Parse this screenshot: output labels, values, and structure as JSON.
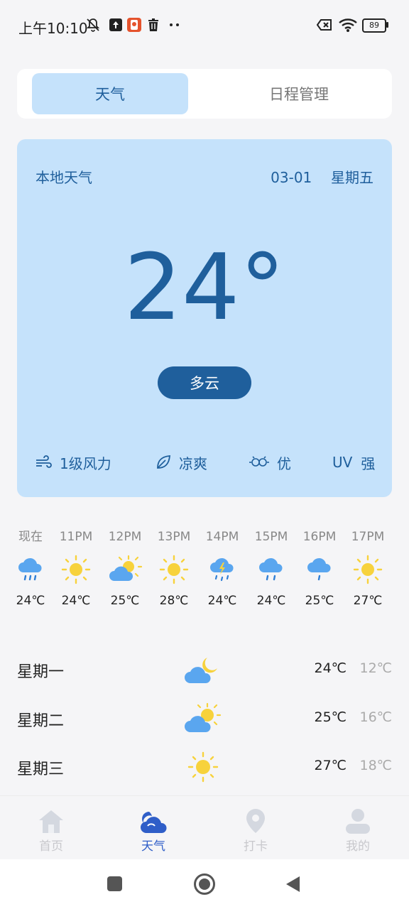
{
  "status_bar": {
    "time": "上午10:10",
    "battery": "89"
  },
  "tabs": {
    "weather": "天气",
    "schedule": "日程管理"
  },
  "card": {
    "location": "本地天气",
    "date": "03-01",
    "weekday": "星期五",
    "temperature": "24°",
    "condition": "多云",
    "wind": "1级风力",
    "feel": "凉爽",
    "air": "优",
    "uv_label": "UV",
    "uv_value": "强"
  },
  "hourly": [
    {
      "time": "现在",
      "icon": "rain-icon",
      "temp": "24℃"
    },
    {
      "time": "11PM",
      "icon": "sun-icon",
      "temp": "24℃"
    },
    {
      "time": "12PM",
      "icon": "partly-cloudy-icon",
      "temp": "25℃"
    },
    {
      "time": "13PM",
      "icon": "sun-icon",
      "temp": "28℃"
    },
    {
      "time": "14PM",
      "icon": "thunderstorm-icon",
      "temp": "24℃"
    },
    {
      "time": "15PM",
      "icon": "rain-icon",
      "temp": "24℃"
    },
    {
      "time": "16PM",
      "icon": "light-rain-icon",
      "temp": "25℃"
    },
    {
      "time": "17PM",
      "icon": "sun-icon",
      "temp": "27℃"
    }
  ],
  "daily": [
    {
      "day": "星期一",
      "icon": "cloudy-night-icon",
      "high": "24℃",
      "low": "12℃"
    },
    {
      "day": "星期二",
      "icon": "partly-cloudy-icon",
      "high": "25℃",
      "low": "16℃"
    },
    {
      "day": "星期三",
      "icon": "sun-icon",
      "high": "27℃",
      "low": "18℃"
    }
  ],
  "bottom_nav": [
    {
      "label": "首页",
      "icon": "home-icon"
    },
    {
      "label": "天气",
      "icon": "weather-icon"
    },
    {
      "label": "打卡",
      "icon": "location-pin-icon"
    },
    {
      "label": "我的",
      "icon": "user-icon"
    }
  ],
  "colors": {
    "accent": "#1f5f9c",
    "card_bg": "#c5e2fb",
    "nav_active": "#2f5ec8"
  }
}
